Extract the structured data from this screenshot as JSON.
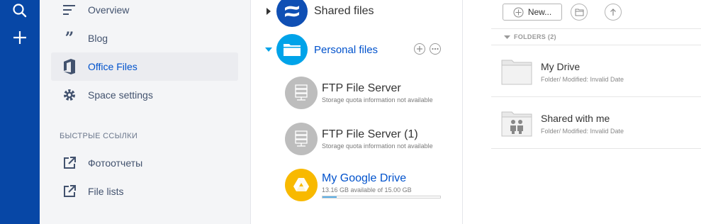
{
  "sidebar": {
    "items": [
      {
        "label": "Overview",
        "icon": "overview-icon"
      },
      {
        "label": "Blog",
        "icon": "quote-icon"
      },
      {
        "label": "Office Files",
        "icon": "office-icon",
        "active": true
      },
      {
        "label": "Space settings",
        "icon": "gear-icon"
      }
    ],
    "quick_links_title": "БЫСТРЫЕ ССЫЛКИ",
    "quick_links": [
      {
        "label": "Фотоотчеты",
        "icon": "external-link-icon"
      },
      {
        "label": "File lists",
        "icon": "external-link-icon"
      }
    ]
  },
  "tree": {
    "shared_files": "Shared files",
    "personal_files": "Personal files",
    "storages": [
      {
        "name": "FTP File Server",
        "status": "Storage quota information not available"
      },
      {
        "name": "FTP File Server (1)",
        "status": "Storage quota information not available"
      },
      {
        "name": "My Google Drive",
        "status": "13.16 GB available of 15.00 GB",
        "used_fraction": 0.123
      }
    ]
  },
  "main": {
    "new_button": "New...",
    "folders_header": "FOLDERS (2)",
    "folders": [
      {
        "name": "My Drive",
        "meta": "Folder/ Modified: Invalid Date"
      },
      {
        "name": "Shared with me",
        "meta": "Folder/ Modified: Invalid Date"
      }
    ]
  },
  "colors": {
    "rail": "#0747a6",
    "accent": "#0052cc",
    "personal_blue": "#00a3e9",
    "drive_yellow": "#f8b900",
    "server_gray": "#bdbdbd"
  }
}
